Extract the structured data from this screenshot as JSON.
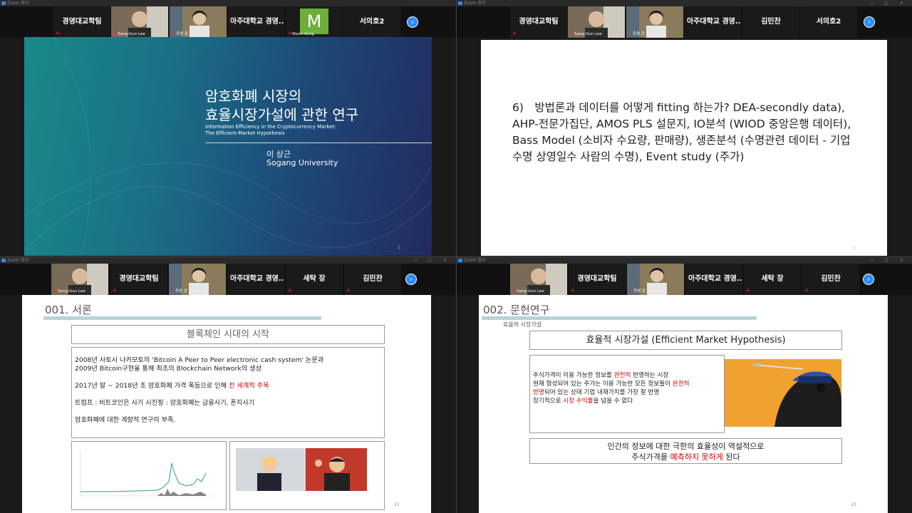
{
  "window_title": "Zoom 회의",
  "strips": {
    "q1": [
      {
        "label": "경영대교학팀"
      },
      {
        "label": "",
        "name": "Sang-Gun Lee"
      },
      {
        "label": "",
        "name": "주영 강"
      },
      {
        "label": "아주대학교 경영..."
      },
      {
        "label": "M",
        "name": "Moon-Song"
      },
      {
        "label": "서의호2"
      }
    ],
    "q2": [
      {
        "label": "경영대교학팀"
      },
      {
        "label": "",
        "name": "Sang-Gun Lee"
      },
      {
        "label": "",
        "name": "주영 강"
      },
      {
        "label": "아주대학교 경영..."
      },
      {
        "label": "김민찬"
      },
      {
        "label": "서의호2"
      }
    ],
    "q3": [
      {
        "label": "",
        "name": "Sang-Gun Lee"
      },
      {
        "label": "경영대교학팀"
      },
      {
        "label": "",
        "name": "주영 강"
      },
      {
        "label": "아주대학교 경영..."
      },
      {
        "label": "세탁 장"
      },
      {
        "label": "김민찬"
      }
    ],
    "q4": [
      {
        "label": "",
        "name": "Sang-Gun Lee"
      },
      {
        "label": "경영대교학팀"
      },
      {
        "label": "",
        "name": "주영 강"
      },
      {
        "label": "아주대학교 경영..."
      },
      {
        "label": "세탁 장"
      },
      {
        "label": "김민찬"
      }
    ]
  },
  "next_icon": "›",
  "slide1": {
    "title_line1": "암호화폐 시장의",
    "title_line2": "효율시장가설에 관한 연구",
    "subtitle_line1": "Information Efficiency in the Cryptocurrency Market:",
    "subtitle_line2": "The Efficient-Market Hypothesis",
    "author": "이 상근",
    "affiliation": "Sogang University",
    "page": "1"
  },
  "slide2": {
    "body": "6)　방법론과 데이터를 어떻게 fitting 하는가? DEA-secondly data), AHP-전문가집단, AMOS PLS 설문지, IO분석 (WIOD 중앙은행 데이터), Bass Model (소비자 수요량, 판매량), 생존분석 (수명관련 데이터 - 기업수명 상영일수 사람의 수명), Event study (주가)",
    "page": "7"
  },
  "slide3": {
    "heading": "001. 서론",
    "box_title": "블록체인 시대의 시작",
    "p1a": "2008년 사토시 나카모토의 'Bitcoin A Peer to Peer electronic cash system' 논문과",
    "p1b": "2009년 Bitcoin구현을 통해 최초의 Blockchain Network의 생성",
    "p2a": "2017년 말 ~ 2018년 초 암호화폐 가격 폭등으로 인해 ",
    "p2b": "전 세계적 주목",
    "p3": "트럼프 : 비트코인은 사기 시진핑 : 암호화폐는 금융사기, 폰지사기",
    "p4": "암호화폐에 대한 계량적 연구의 부족.",
    "page": "21"
  },
  "slide4": {
    "heading": "002. 문헌연구",
    "subheading": "효율적 시장가설",
    "box_title": "효율적 시장가설 (Efficient Market Hypothesis)",
    "l1a": "주식가격이 이용 가능한 정보를 ",
    "l1b": "완전히",
    "l1c": " 반영하는 시장",
    "l2a": "현재 형성되어 있는 주가는 이용 가능한 모든 정보들이 ",
    "l2b": "완전히",
    "l3a": "반영",
    "l3b": "되어 있는 상태 기업 내재가치를 가장 잘 반영",
    "l4a": "장기적으로 ",
    "l4b": "시장 수익률",
    "l4c": "을 넘을 수 없다",
    "c1": "인간의 정보에 대한 극한의 효율성이 역설적으로",
    "c2a": "주식가격을 ",
    "c2b": "예측하지 못하게",
    "c2c": " 된다",
    "page": "23"
  },
  "colors": {
    "zoom_blue": "#2d8cff",
    "active_speaker": "#a8e23b",
    "emphasis_red": "#c00000",
    "slide1_gradient_start": "#1a8a8a",
    "slide1_gradient_end": "#232a5e"
  }
}
